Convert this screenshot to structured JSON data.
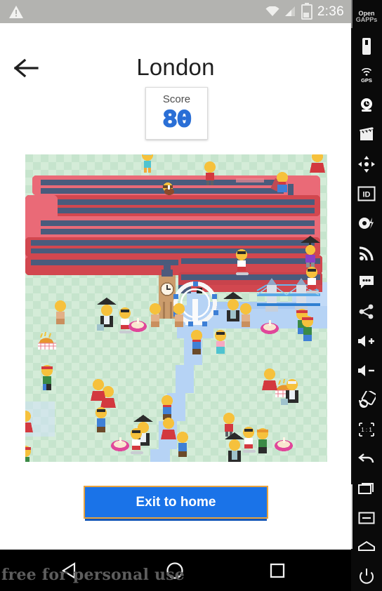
{
  "status_bar": {
    "warning_icon": "warning-triangle-icon",
    "wifi_icon": "wifi-icon",
    "signal_icon": "cell-signal-icon",
    "battery_icon": "battery-icon",
    "time": "2:36"
  },
  "app_bar": {
    "back_icon": "arrow-left-icon",
    "title": "London"
  },
  "score_card": {
    "label": "Score",
    "value": "80"
  },
  "game": {
    "name": "london-snake-board",
    "board_background": "#cde8d3",
    "snake_body_color": "#3f4f6e",
    "snake_bus_color": "#e9606c",
    "river_color": "#aecdf2",
    "landmarks": [
      "big-ben",
      "london-eye",
      "tower-bridge"
    ],
    "items": [
      "pedestrian",
      "skateboarder",
      "fish-and-chips",
      "teacup",
      "ice-cream",
      "umbrella-man",
      "bowler-hat-man"
    ]
  },
  "actions": {
    "exit_label": "Exit to home",
    "exit_bg": "#1a73e8",
    "exit_border": "#e8a33d"
  },
  "nav_bar": {
    "back_icon": "nav-back-triangle-icon",
    "home_icon": "nav-home-circle-icon",
    "recents_icon": "nav-recents-square-icon"
  },
  "watermark": {
    "text": "free for personal use"
  },
  "sidebar": {
    "logo_line1": "Open",
    "logo_line2": "GAPPs",
    "items": [
      {
        "name": "device-icon",
        "label": ""
      },
      {
        "name": "gps-icon",
        "label": "GPS"
      },
      {
        "name": "camera-icon",
        "label": ""
      },
      {
        "name": "video-record-icon",
        "label": ""
      },
      {
        "name": "dpad-move-icon",
        "label": ""
      },
      {
        "name": "id-icon",
        "label": "ID"
      },
      {
        "name": "screenshot-flash-icon",
        "label": ""
      },
      {
        "name": "signal-rss-icon",
        "label": ""
      },
      {
        "name": "sms-message-icon",
        "label": ""
      },
      {
        "name": "share-icon",
        "label": ""
      },
      {
        "name": "volume-up-icon",
        "label": ""
      },
      {
        "name": "volume-down-icon",
        "label": ""
      },
      {
        "name": "rotate-screen-icon",
        "label": ""
      },
      {
        "name": "resize-one-to-one-icon",
        "label": ""
      },
      {
        "name": "back-arrow-icon",
        "label": ""
      },
      {
        "name": "recents-icon",
        "label": ""
      },
      {
        "name": "menu-icon",
        "label": ""
      },
      {
        "name": "home-icon",
        "label": ""
      },
      {
        "name": "power-icon",
        "label": ""
      }
    ]
  }
}
